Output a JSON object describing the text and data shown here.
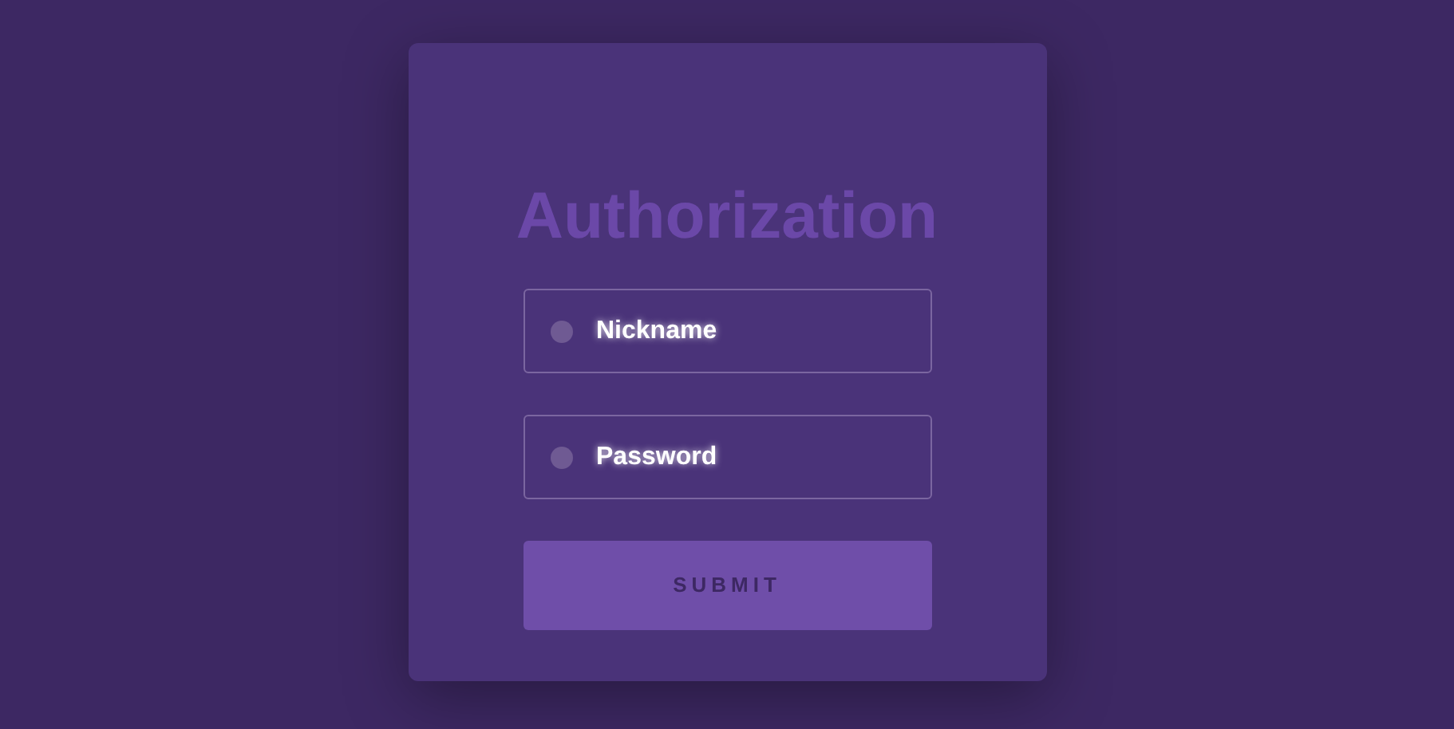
{
  "title": "Authorization",
  "fields": [
    {
      "label": "Nickname"
    },
    {
      "label": "Password"
    }
  ],
  "submit": "SUBMIT"
}
